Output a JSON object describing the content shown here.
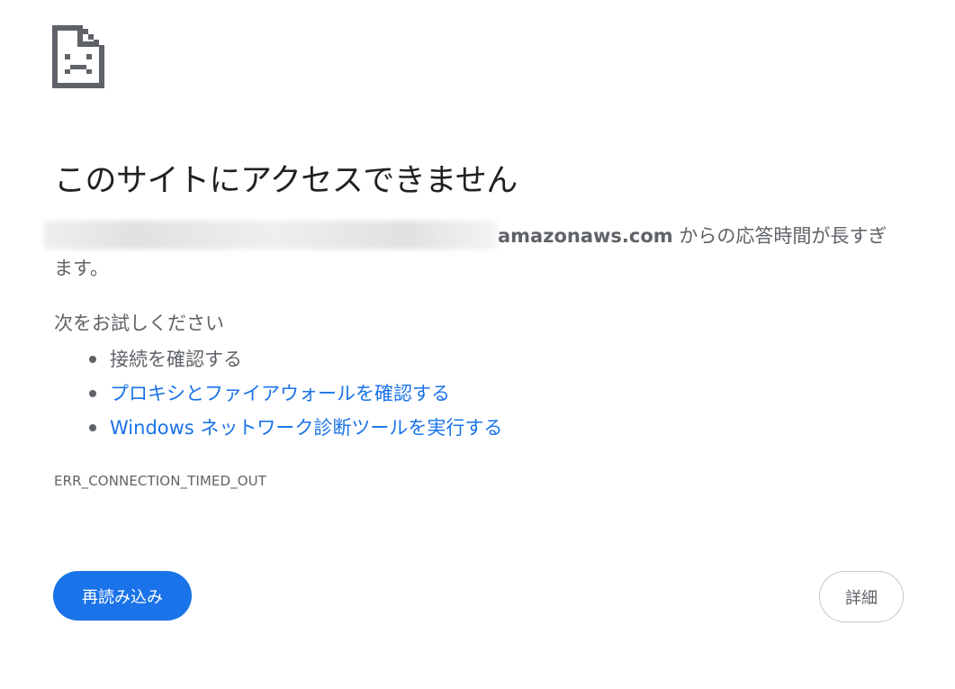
{
  "error": {
    "title": "このサイトにアクセスできません",
    "host_suffix": "amazonaws.com",
    "summary_tail": " からの応答時間が長すぎます。",
    "suggestions_heading": "次をお試しください",
    "suggestions": [
      {
        "label": "接続を確認する",
        "link": false
      },
      {
        "label": "プロキシとファイアウォールを確認する",
        "link": true
      },
      {
        "label": "Windows ネットワーク診断ツールを実行する",
        "link": true
      }
    ],
    "code": "ERR_CONNECTION_TIMED_OUT"
  },
  "buttons": {
    "reload_label": "再読み込み",
    "details_label": "詳細"
  },
  "colors": {
    "link": "#1a73e8",
    "primary_button": "#1a73e8",
    "text": "#5f6368",
    "title": "#202124"
  },
  "icons": {
    "error": "sad-page-icon"
  }
}
